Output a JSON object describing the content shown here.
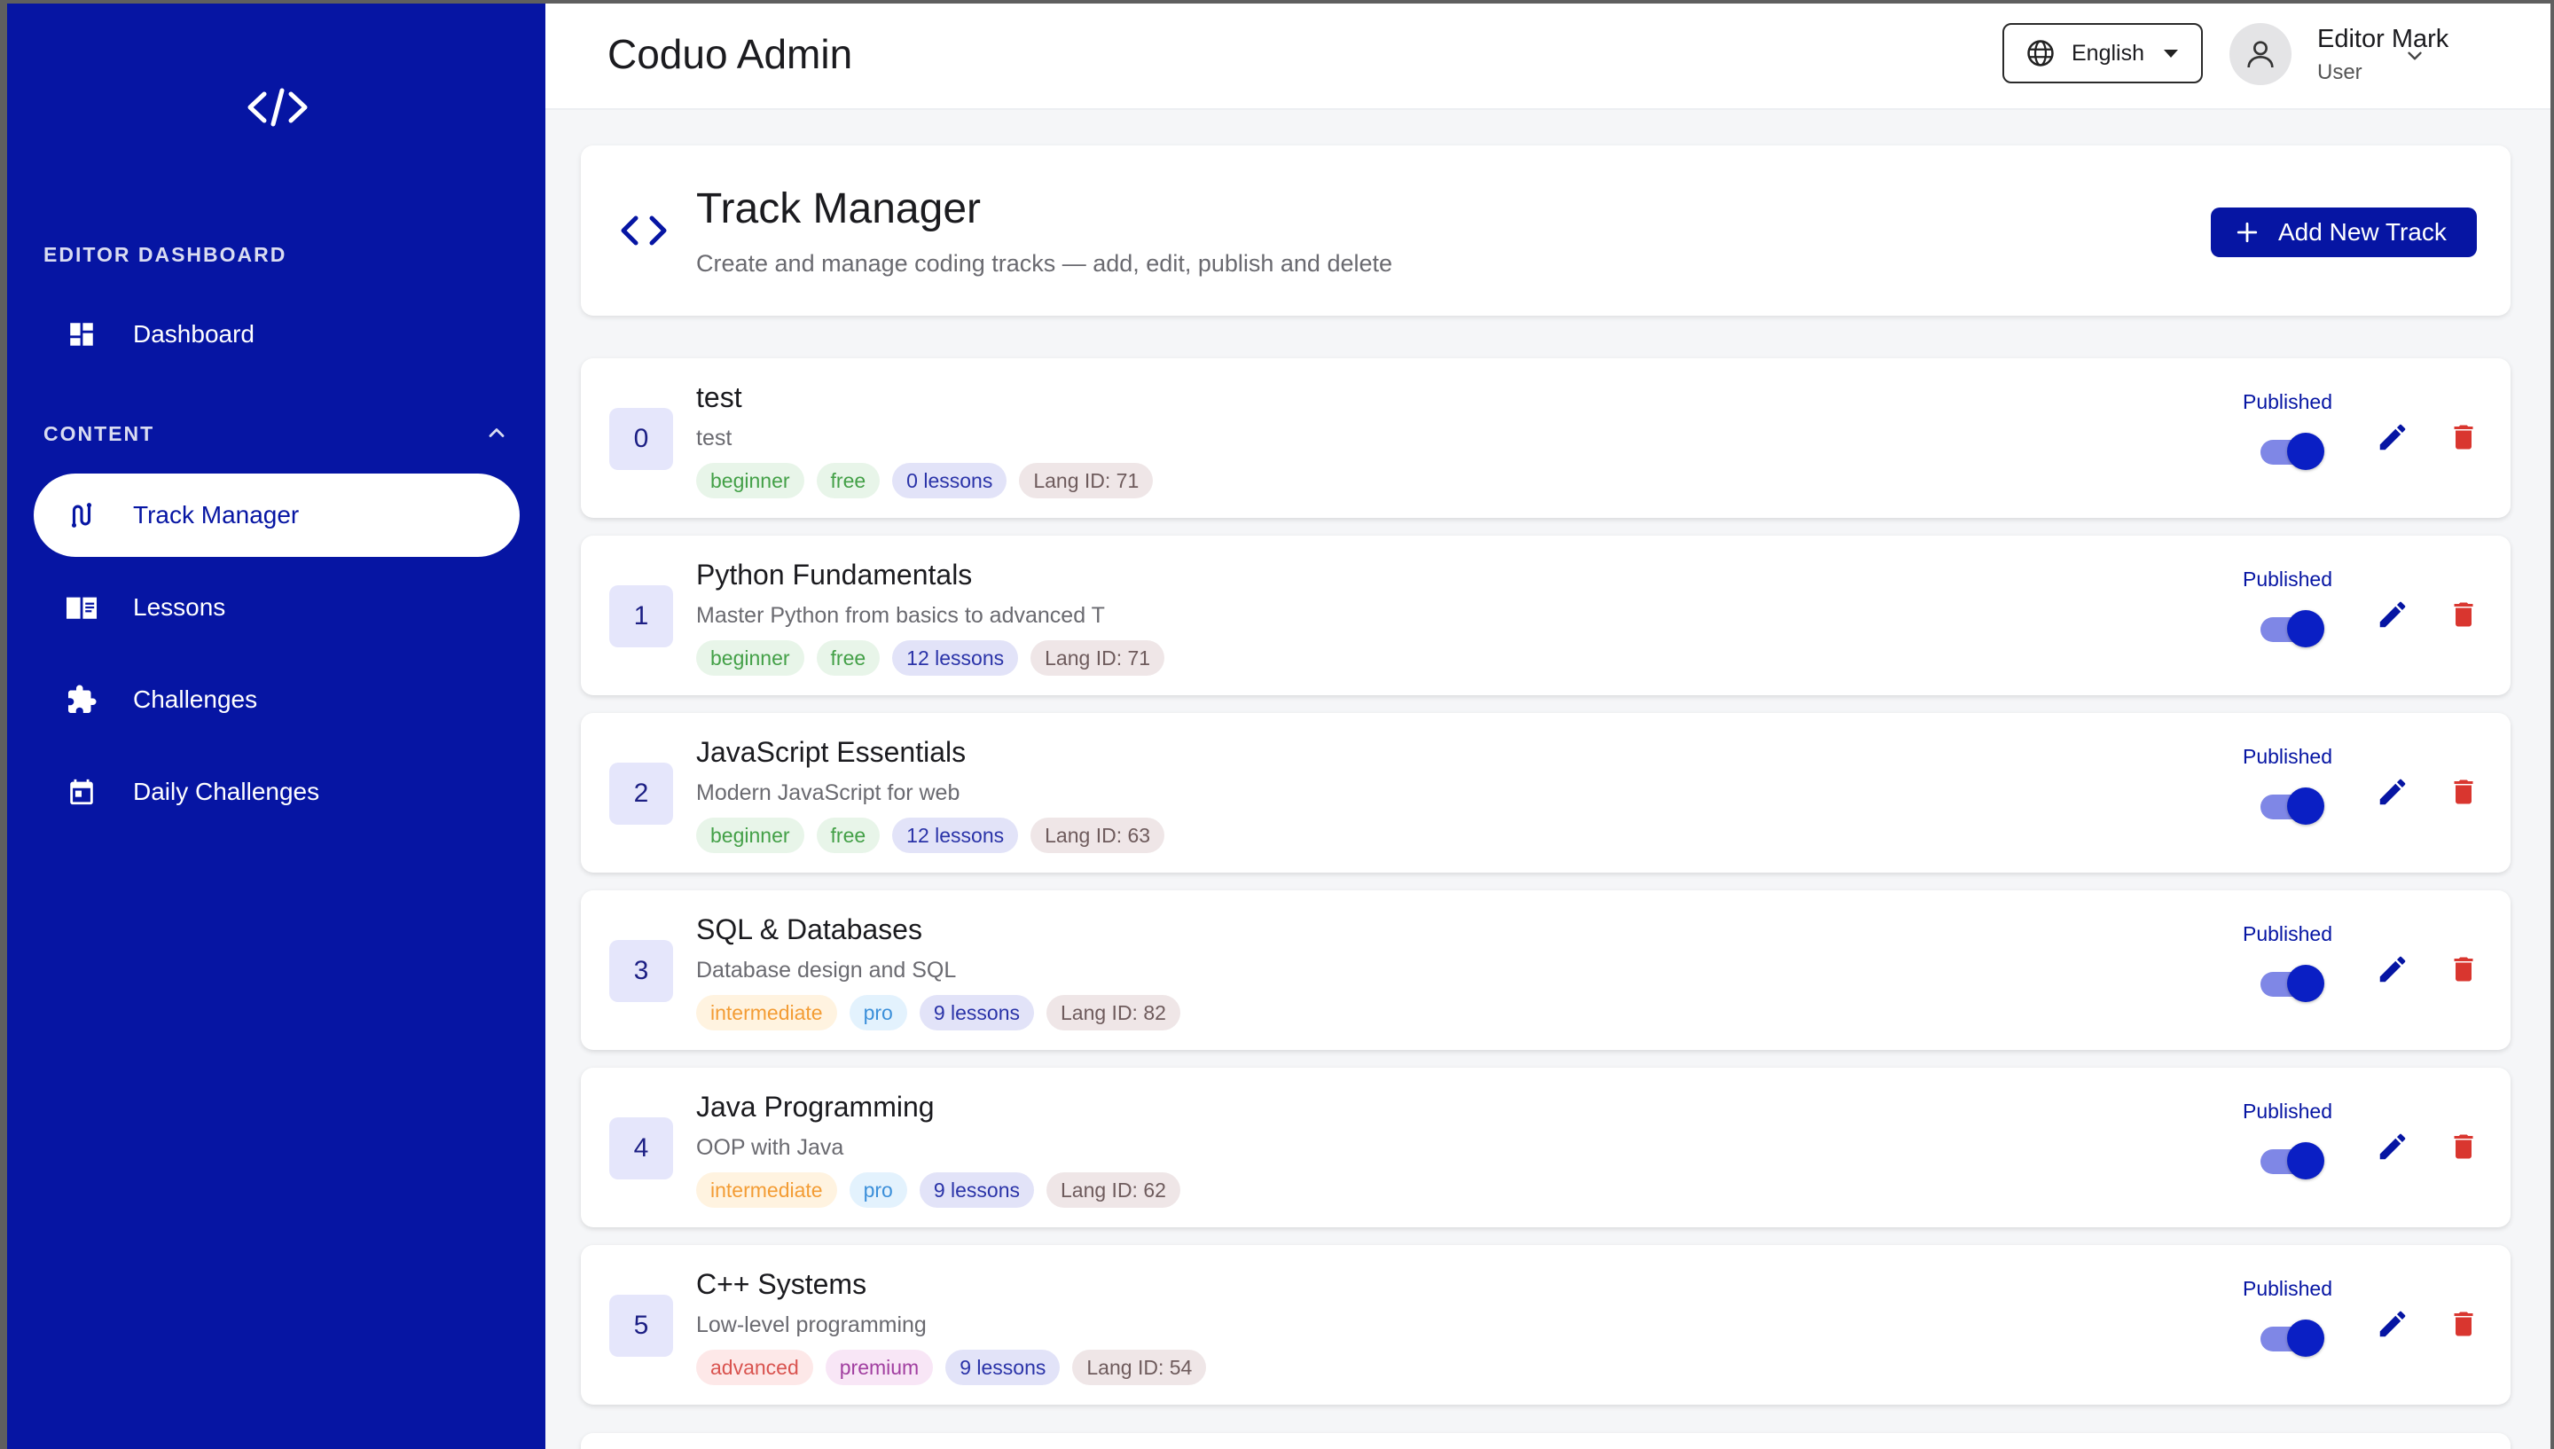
{
  "sidebar": {
    "logo_icon": "code-brackets-icon",
    "sections": [
      {
        "title": "EDITOR DASHBOARD"
      },
      {
        "title": "CONTENT"
      }
    ],
    "items": [
      {
        "label": "Dashboard",
        "icon": "dashboard-icon"
      },
      {
        "label": "Track Manager",
        "icon": "route-icon",
        "active": true
      },
      {
        "label": "Lessons",
        "icon": "book-icon"
      },
      {
        "label": "Challenges",
        "icon": "puzzle-icon"
      },
      {
        "label": "Daily Challenges",
        "icon": "calendar-icon"
      }
    ]
  },
  "topbar": {
    "app_title": "Coduo Admin",
    "language": "English",
    "user": {
      "name": "Editor Mark",
      "role": "User"
    }
  },
  "header": {
    "title": "Track Manager",
    "subtitle": "Create and manage coding tracks — add, edit, publish and delete",
    "add_button_label": "Add New Track"
  },
  "colors": {
    "primary": "#0615a3",
    "published_toggle": "#0a1fc4",
    "delete": "#d9362f"
  },
  "tracks": [
    {
      "index": "0",
      "title": "test",
      "description": "test",
      "level": "beginner",
      "tier": "free",
      "lessons": "0 lessons",
      "lang_id": "Lang ID: 71",
      "status": "Published",
      "published": true
    },
    {
      "index": "1",
      "title": "Python Fundamentals",
      "description": "Master Python from basics to advanced T",
      "level": "beginner",
      "tier": "free",
      "lessons": "12 lessons",
      "lang_id": "Lang ID: 71",
      "status": "Published",
      "published": true
    },
    {
      "index": "2",
      "title": "JavaScript Essentials",
      "description": "Modern JavaScript for web",
      "level": "beginner",
      "tier": "free",
      "lessons": "12 lessons",
      "lang_id": "Lang ID: 63",
      "status": "Published",
      "published": true
    },
    {
      "index": "3",
      "title": "SQL & Databases",
      "description": "Database design and SQL",
      "level": "intermediate",
      "tier": "pro",
      "lessons": "9 lessons",
      "lang_id": "Lang ID: 82",
      "status": "Published",
      "published": true
    },
    {
      "index": "4",
      "title": "Java Programming",
      "description": "OOP with Java",
      "level": "intermediate",
      "tier": "pro",
      "lessons": "9 lessons",
      "lang_id": "Lang ID: 62",
      "status": "Published",
      "published": true
    },
    {
      "index": "5",
      "title": "C++ Systems",
      "description": "Low-level programming",
      "level": "advanced",
      "tier": "premium",
      "lessons": "9 lessons",
      "lang_id": "Lang ID: 54",
      "status": "Published",
      "published": true
    }
  ]
}
